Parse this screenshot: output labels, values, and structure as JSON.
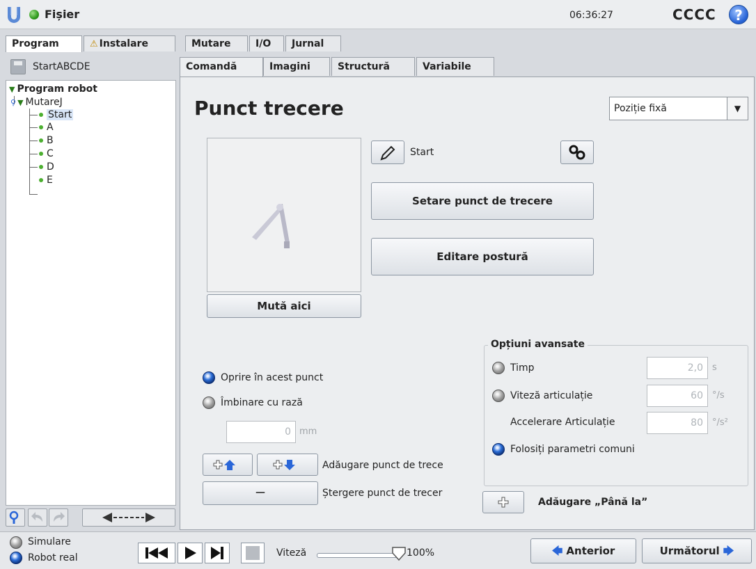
{
  "app": {
    "file_menu": "Fișier",
    "clock": "06:36:27",
    "robot_name": "CCCC",
    "help_symbol": "?"
  },
  "main_tabs": [
    {
      "label": "Program",
      "active": true
    },
    {
      "label": "Instalare",
      "active": false,
      "warning": true
    },
    {
      "label": "Mutare",
      "active": false
    },
    {
      "label": "I/O",
      "active": false
    },
    {
      "label": "Jurnal",
      "active": false
    }
  ],
  "program": {
    "name": "StartABCDE",
    "tree": {
      "root": "Program robot",
      "move": "MutareJ",
      "waypoints": [
        "Start",
        "A",
        "B",
        "C",
        "D",
        "E"
      ],
      "selected": "Start"
    }
  },
  "sub_tabs": [
    {
      "label": "Comandă",
      "active": true
    },
    {
      "label": "Imagini",
      "active": false
    },
    {
      "label": "Structură",
      "active": false
    },
    {
      "label": "Variabile",
      "active": false
    }
  ],
  "waypoint": {
    "title": "Punct trecere",
    "type_selected": "Poziție fixă",
    "name": "Start",
    "set_button": "Setare punct de trecere",
    "edit_pose_button": "Editare postură",
    "move_here_button": "Mută aici",
    "stop_option": "Oprire în acest punct",
    "blend_option": "Îmbinare cu rază",
    "blend_value": "0",
    "blend_unit": "mm",
    "add_waypoint_label": "Adăugare punct de trece",
    "delete_waypoint_label": "Ștergere punct de trecer",
    "delete_symbol": "—",
    "add_until_label": "Adăugare „Până la”"
  },
  "advanced": {
    "title": "Opțiuni avansate",
    "time_label": "Timp",
    "time_value": "2,0",
    "time_unit": "s",
    "joint_speed_label": "Viteză articulație",
    "joint_speed_value": "60",
    "joint_speed_unit": "°/s",
    "joint_accel_label": "Accelerare Articulație",
    "joint_accel_value": "80",
    "joint_accel_unit": "°/s²",
    "shared_params_label": "Folosiți parametri comuni"
  },
  "bottom": {
    "simulation_label": "Simulare",
    "real_robot_label": "Robot real",
    "speed_label": "Viteză",
    "speed_value": "100%",
    "speed_fraction": 1.0,
    "prev_button": "Anterior",
    "next_button": "Următorul"
  }
}
